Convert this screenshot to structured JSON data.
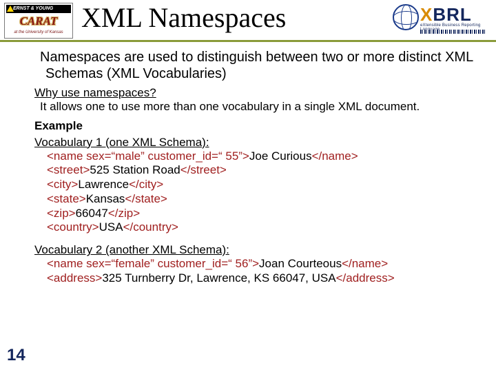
{
  "logos": {
    "left": {
      "ey": "ERNST & YOUNG",
      "carat": "CARAT",
      "tag": "at the University of Kansas"
    },
    "right": {
      "text": "XBRL",
      "x": "X",
      "brl": "BRL",
      "sub": "eXtensible Business Reporting Language"
    }
  },
  "title": "XML Namespaces",
  "intro": " Namespaces are used to distinguish between two or more distinct XML Schemas (XML Vocabularies)",
  "why": {
    "heading": "Why use namespaces?",
    "body": " It allows one to use more than one vocabulary in a single XML document."
  },
  "example_label": "Example",
  "vocab1": {
    "heading": "Vocabulary 1 (one XML Schema):",
    "lines": [
      {
        "open": "<name sex=“male” customer_id=“ 55”>",
        "text": "Joe Curious",
        "close": "</name>"
      },
      {
        "open": "<street>",
        "text": "525 Station Road",
        "close": "</street>"
      },
      {
        "open": "<city>",
        "text": "Lawrence",
        "close": "</city>"
      },
      {
        "open": "<state>",
        "text": "Kansas",
        "close": "</state>"
      },
      {
        "open": "<zip>",
        "text": "66047",
        "close": "</zip>"
      },
      {
        "open": "<country>",
        "text": "USA",
        "close": "</country>"
      }
    ]
  },
  "vocab2": {
    "heading": "Vocabulary 2 (another XML Schema):",
    "lines": [
      {
        "open": "<name sex=“female” customer_id=“ 56”>",
        "text": "Joan Courteous",
        "close": "</name>"
      },
      {
        "open": "<address>",
        "text": "325 Turnberry Dr, Lawrence, KS 66047, USA",
        "close": "</address>"
      }
    ]
  },
  "slide_number": "14"
}
